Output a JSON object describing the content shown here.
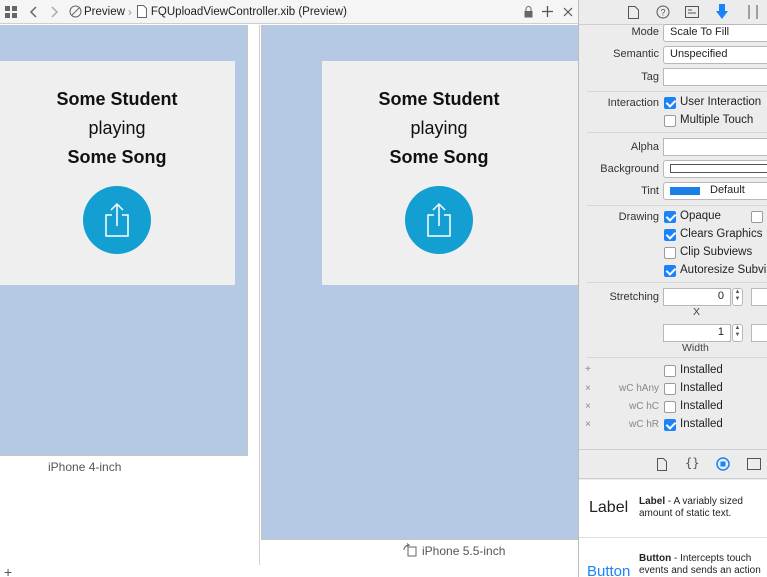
{
  "jumpbar": {
    "crumb_preview": "Preview",
    "crumb_file": "FQUploadViewController.xib (Preview)"
  },
  "devices": [
    {
      "label": "iPhone 4-inch",
      "card": {
        "name": "Some Student",
        "verb": "playing",
        "song": "Some Song"
      }
    },
    {
      "label": "iPhone 5.5-inch",
      "card": {
        "name": "Some Student",
        "verb": "playing",
        "song": "Some Song"
      }
    }
  ],
  "inspector": {
    "mode_label": "Mode",
    "mode_value": "Scale To Fill",
    "semantic_label": "Semantic",
    "semantic_value": "Unspecified",
    "tag_label": "Tag",
    "tag_value": "",
    "interaction_label": "Interaction",
    "user_interaction": "User Interaction",
    "multiple_touch": "Multiple Touch",
    "alpha_label": "Alpha",
    "alpha_value": "",
    "background_label": "Background",
    "tint_label": "Tint",
    "tint_value": "Default",
    "tint_color": "#1a7fe6",
    "drawing_label": "Drawing",
    "opaque": "Opaque",
    "clears_graphics": "Clears Graphics",
    "clip_subviews": "Clip Subviews",
    "autoresize_subviews": "Autoresize Subvi",
    "stretching_label": "Stretching",
    "stretch_x_value": "0",
    "stretch_x_label": "X",
    "stretch_w_value": "1",
    "stretch_w_label": "Width",
    "installed_rows": [
      {
        "prefix": "+",
        "size_class": "",
        "label": "Installed",
        "checked": false
      },
      {
        "prefix": "×",
        "size_class": "wC hAny",
        "label": "Installed",
        "checked": false
      },
      {
        "prefix": "×",
        "size_class": "wC hC",
        "label": "Installed",
        "checked": false
      },
      {
        "prefix": "×",
        "size_class": "wC hR",
        "label": "Installed",
        "checked": true
      }
    ]
  },
  "library": [
    {
      "big": "Label",
      "title": "Label",
      "desc": " - A variably sized amount of static text."
    },
    {
      "big": "Button",
      "title": "Button",
      "desc": " - Intercepts touch events and sends an action message to"
    }
  ],
  "canvas_add": "+"
}
